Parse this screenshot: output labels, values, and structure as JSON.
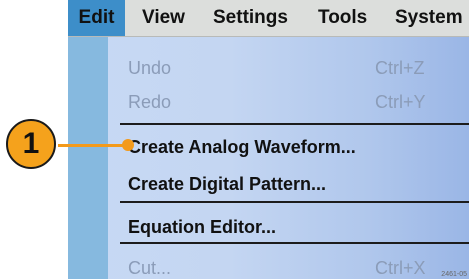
{
  "menubar": {
    "items": [
      {
        "label": "Edit",
        "active": true
      },
      {
        "label": "View"
      },
      {
        "label": "Settings"
      },
      {
        "label": "Tools"
      },
      {
        "label": "System"
      }
    ]
  },
  "edit_menu": {
    "items": [
      {
        "label": "Undo",
        "shortcut": "Ctrl+Z",
        "enabled": false
      },
      {
        "label": "Redo",
        "shortcut": "Ctrl+Y",
        "enabled": false
      },
      {
        "label": "Create Analog Waveform...",
        "enabled": true
      },
      {
        "label": "Create Digital Pattern...",
        "enabled": true
      },
      {
        "label": "Equation Editor...",
        "enabled": true
      },
      {
        "label": "Cut...",
        "shortcut": "Ctrl+X",
        "enabled": false
      }
    ]
  },
  "callout": {
    "number": "1",
    "target": "Create Analog Waveform..."
  },
  "figure_id": "2461-05",
  "colors": {
    "active_menu": "#3d8ec9",
    "menubar_bg": "#dcdedc",
    "dropdown_bg": "#c4d6f2",
    "gutter": "#86b9df",
    "callout": "#f5a21c",
    "disabled_text": "#8b9cb8"
  }
}
